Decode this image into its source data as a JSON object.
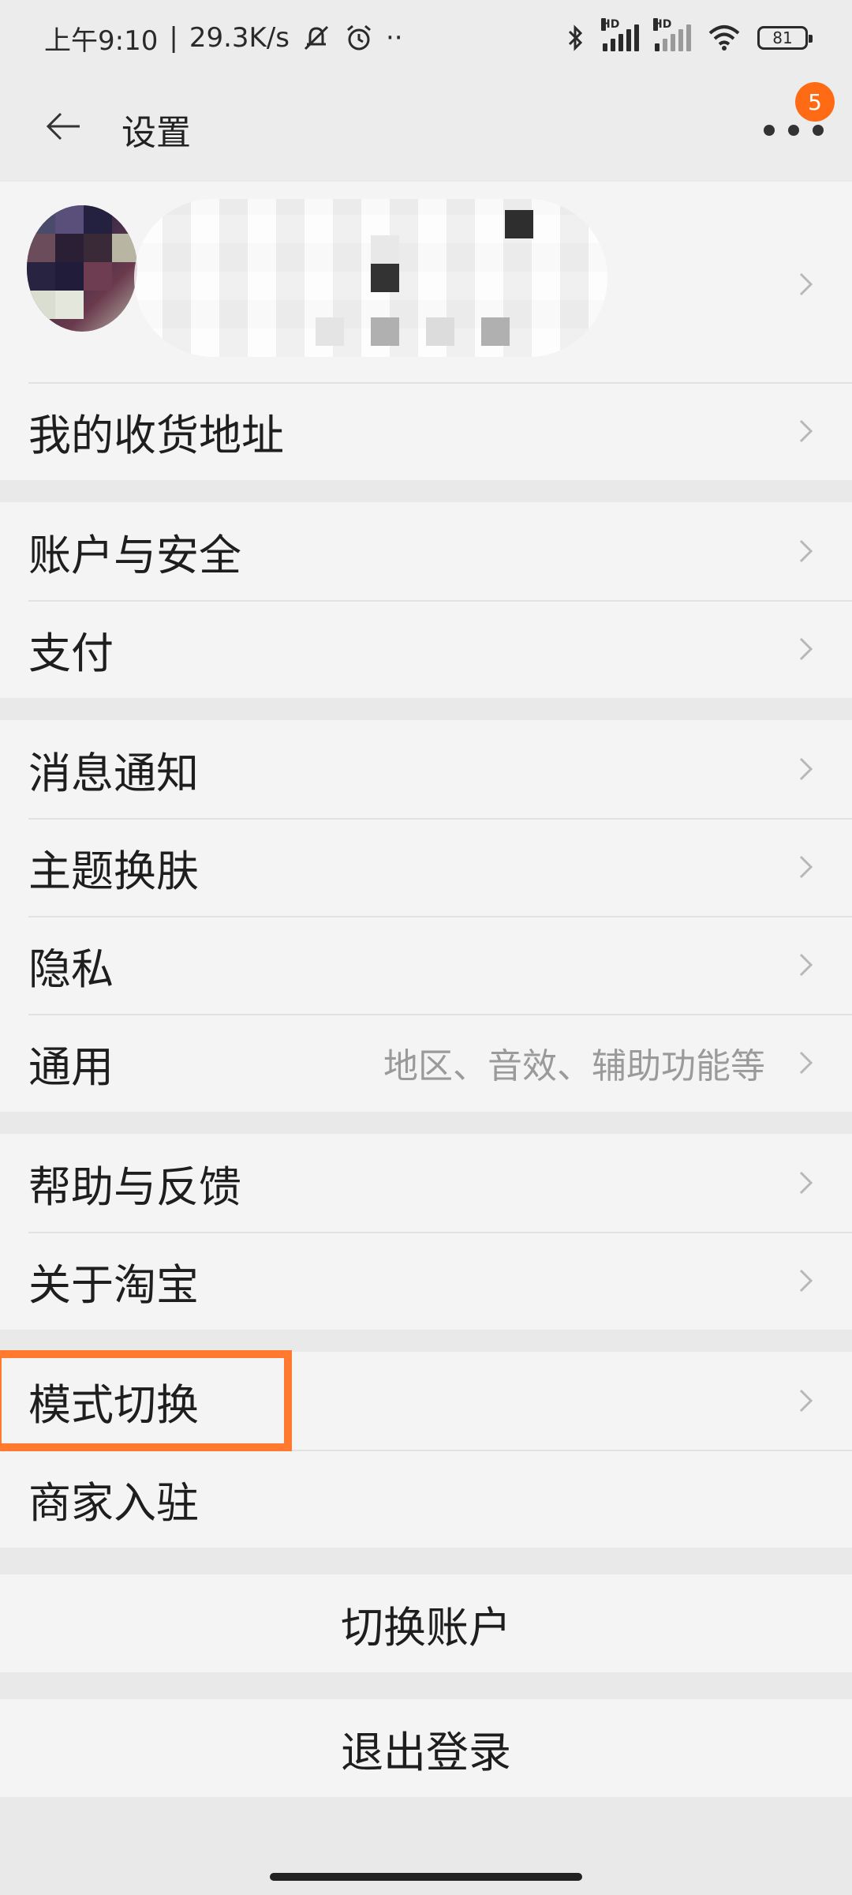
{
  "status_bar": {
    "time": "上午9:10",
    "net_speed": "29.3K/s",
    "dots": "··",
    "battery": "81",
    "signal_hd_1": "HD",
    "signal_hd_2": "HD",
    "icons": [
      "mute-icon",
      "alarm-icon",
      "bluetooth-icon",
      "signal-icon",
      "wifi-icon",
      "battery-icon"
    ]
  },
  "header": {
    "title": "设置",
    "badge": "5"
  },
  "sections": {
    "address": {
      "label": "我的收货地址"
    },
    "account_security": {
      "label": "账户与安全"
    },
    "pay": {
      "label": "支付"
    },
    "notify": {
      "label": "消息通知"
    },
    "theme": {
      "label": "主题换肤"
    },
    "privacy": {
      "label": "隐私"
    },
    "general": {
      "label": "通用",
      "sub": "地区、音效、辅助功能等"
    },
    "help": {
      "label": "帮助与反馈"
    },
    "about": {
      "label": "关于淘宝"
    },
    "mode": {
      "label": "模式切换"
    },
    "merchant": {
      "label": "商家入驻"
    }
  },
  "actions": {
    "switch_account": "切换账户",
    "logout": "退出登录"
  },
  "colors": {
    "accent": "#ff7a2e",
    "badge": "#ff6a14",
    "background": "#e9e9e9",
    "card": "#f4f4f4"
  }
}
